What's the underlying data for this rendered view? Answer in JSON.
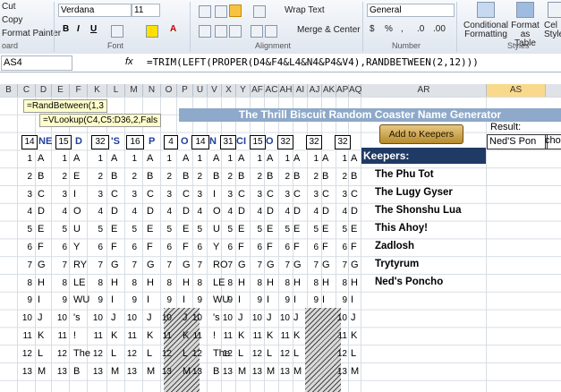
{
  "ribbon": {
    "cut_label": "Cut",
    "copy_label": "Copy",
    "format_painter_label": "Format Painter",
    "clipboard_group": "oard",
    "font_name": "Verdana",
    "font_size": "11",
    "font_group": "Font",
    "alignment_group": "Alignment",
    "wrap_text_label": "Wrap Text",
    "merge_center_label": "Merge & Center",
    "number_format": "General",
    "number_group": "Number",
    "conditional_formatting_label": "Conditional Formatting",
    "format_table_label": "Format as Table",
    "cell_styles_label": "Cel Style",
    "styles_group": "Styles",
    "accent_color": "#1f3a64"
  },
  "formula_bar": {
    "name_box": "AS4",
    "fx": "fx",
    "formula": "=TRIM(LEFT(PROPER(D4&F4&L4&N4&P4&V4),RANDBETWEEN(2,12)))"
  },
  "columns": [
    "B",
    "C",
    "D",
    "E",
    "F",
    "K",
    "L",
    "M",
    "N",
    "O",
    "P",
    "U",
    "V",
    "X",
    "Y",
    "AF",
    "AC",
    "AH",
    "AI",
    "AJ",
    "AK",
    "AP",
    "AQ",
    "AR",
    "AS"
  ],
  "tooltips": {
    "randbetween": "=RandBetween(1,3",
    "vlookup": "=VLookup(C4,C5:D36,2,Fals"
  },
  "title": "The Thrill Biscuit Random Coaster Name Generator",
  "top_row": {
    "n1": "14",
    "l1": "NE",
    "n2": "15",
    "l2": "D",
    "n3": "32",
    "l3": "'S",
    "n4": "16",
    "l4": "P",
    "n5": "4",
    "l5": "O",
    "n6": "14",
    "l6": "N",
    "n7": "31",
    "l7": "CI",
    "n8": "15",
    "l8": "O",
    "n9": "32",
    "n10": "32",
    "n11": "32"
  },
  "add_button": "Add to Keepers",
  "result_label": "Result:",
  "result_value": "Ned'S Pon",
  "result_overflow": "cho",
  "keepers_header": "Keepers:",
  "keepers": [
    "The Phu Tot",
    "The Lugy Gyser",
    "The Shonshu Lua",
    "This Ahoy!",
    "Zadlosh",
    "Trytyrum",
    "Ned's Poncho"
  ],
  "rows": [
    {
      "n": "1",
      "c1": "A",
      "c2": "A",
      "c3": "A",
      "c4": "A",
      "c5": "A",
      "c6": "A",
      "c7": "A",
      "c8": "A"
    },
    {
      "n": "2",
      "c1": "B",
      "c2": "E",
      "c3": "B",
      "c4": "B",
      "c5": "B",
      "c6": "B",
      "c7": "B",
      "c8": "B"
    },
    {
      "n": "3",
      "c1": "C",
      "c2": "I",
      "c3": "C",
      "c4": "C",
      "c5": "C",
      "c6": "I",
      "c7": "C",
      "c8": "C"
    },
    {
      "n": "4",
      "c1": "D",
      "c2": "O",
      "c3": "D",
      "c4": "D",
      "c5": "D",
      "c6": "O",
      "c7": "D",
      "c8": "D"
    },
    {
      "n": "5",
      "c1": "E",
      "c2": "U",
      "c3": "E",
      "c4": "E",
      "c5": "E",
      "c6": "U",
      "c7": "E",
      "c8": "E"
    },
    {
      "n": "6",
      "c1": "F",
      "c2": "Y",
      "c3": "F",
      "c4": "F",
      "c5": "F",
      "c6": "Y",
      "c7": "F",
      "c8": "F"
    },
    {
      "n": "7",
      "c1": "G",
      "c2": "RY",
      "c3": "G",
      "c4": "G",
      "c5": "G",
      "c6": "RO",
      "c7": "G",
      "c8": "G"
    },
    {
      "n": "8",
      "c1": "H",
      "c2": "LE",
      "c3": "H",
      "c4": "H",
      "c5": "H",
      "c6": "LE",
      "c7": "H",
      "c8": "H"
    },
    {
      "n": "9",
      "c1": "I",
      "c2": "WU",
      "c3": "I",
      "c4": "I",
      "c5": "I",
      "c6": "WU",
      "c7": "I",
      "c8": "I"
    },
    {
      "n": "10",
      "c1": "J",
      "c2": "'s",
      "c3": "J",
      "c4": "J",
      "c5": "J",
      "c6": "'s",
      "c7": "J",
      "c8": "J"
    },
    {
      "n": "11",
      "c1": "K",
      "c2": "!",
      "c3": "K",
      "c4": "K",
      "c5": "K",
      "c6": "!",
      "c7": "K",
      "c8": "K"
    },
    {
      "n": "12",
      "c1": "L",
      "c2": "The",
      "c3": "L",
      "c4": "L",
      "c5": "L",
      "c6": "The",
      "c7": "L",
      "c8": "L"
    },
    {
      "n": "13",
      "c1": "M",
      "c2": "B",
      "c3": "M",
      "c4": "M",
      "c5": "M",
      "c6": "B",
      "c7": "M",
      "c8": "M"
    }
  ]
}
